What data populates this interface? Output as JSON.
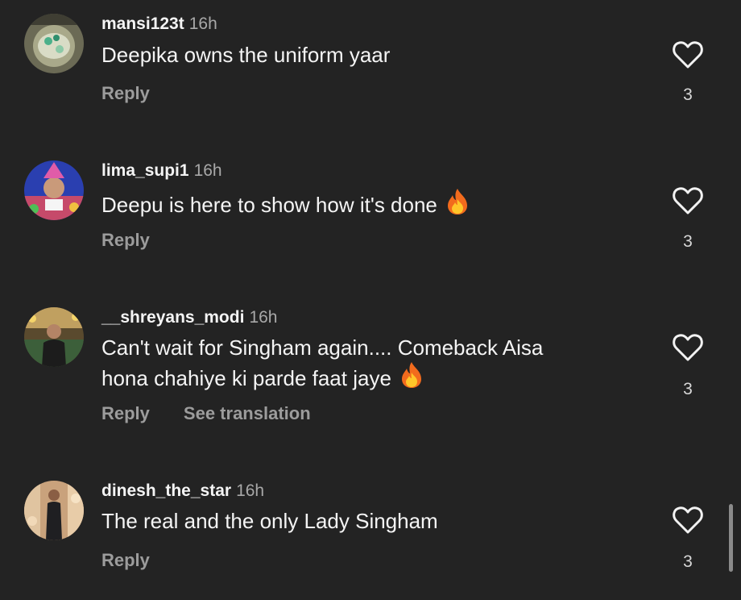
{
  "comments": [
    {
      "username": "mansi123t",
      "time": "16h",
      "text": "Deepika owns the uniform yaar",
      "reply_label": "Reply",
      "likes": "3",
      "has_fire": false
    },
    {
      "username": "lima_supi1",
      "time": "16h",
      "text": "Deepu is here to show how it's done",
      "reply_label": "Reply",
      "likes": "3",
      "has_fire": true
    },
    {
      "username": "__shreyans_modi",
      "time": "16h",
      "text": "Can't wait for Singham again.... Comeback Aisa",
      "text_line2": "hona chahiye ki parde faat jaye",
      "reply_label": "Reply",
      "translation_label": "See translation",
      "likes": "3",
      "has_fire": true
    },
    {
      "username": "dinesh_the_star",
      "time": "16h",
      "text": "The real and the only Lady Singham",
      "reply_label": "Reply",
      "likes": "3",
      "has_fire": false
    }
  ],
  "icons": {
    "like": "heart-outline-icon",
    "emoji": "fire-emoji"
  },
  "colors": {
    "background": "#232323",
    "text": "#f4f4f4",
    "muted": "#a8a8a8"
  }
}
